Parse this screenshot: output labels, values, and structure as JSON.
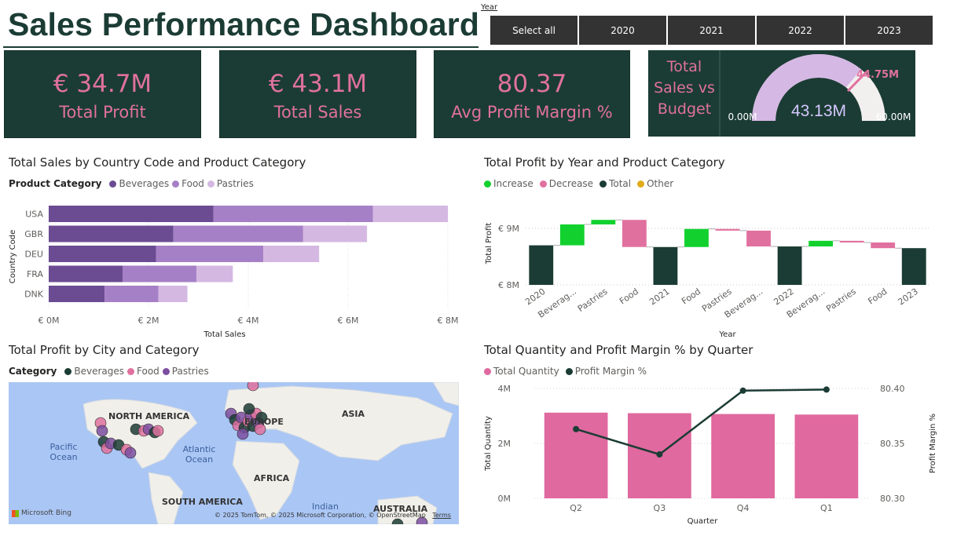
{
  "header": {
    "title": "Sales Performance Dashboard"
  },
  "slicer": {
    "label": "Year",
    "options": [
      "Select all",
      "2020",
      "2021",
      "2022",
      "2023"
    ]
  },
  "kpis": {
    "profit": {
      "value": "€ 34.7M",
      "label": "Total Profit"
    },
    "sales": {
      "value": "€ 43.1M",
      "label": "Total Sales"
    },
    "margin": {
      "value": "80.37",
      "label": "Avg Profit Margin %"
    }
  },
  "gauge": {
    "label_line1": "Total",
    "label_line2": "Sales vs",
    "label_line3": "Budget",
    "value_text": "43.13M",
    "min_text": "0.00M",
    "max_text": "60.00M",
    "target_text": "44.75M",
    "value": 43.13,
    "min": 0,
    "max": 60,
    "target": 44.75,
    "colors": {
      "fill": "#d5b8e4",
      "track": "#f2efef",
      "target": "#e0719f",
      "value_text": "#d5c8ff"
    }
  },
  "sales_chart": {
    "title": "Total Sales by Country Code and Product Category",
    "legend_title": "Product Category",
    "xlabel": "Total Sales",
    "ylabel": "Country Code",
    "x_ticks": [
      "€ 0M",
      "€ 2M",
      "€ 4M",
      "€ 6M",
      "€ 8M"
    ]
  },
  "waterfall_chart": {
    "title": "Total Profit by Year and Product Category",
    "legend": [
      "Increase",
      "Decrease",
      "Total",
      "Other"
    ],
    "xlabel": "Year",
    "ylabel": "Total Profit",
    "y_ticks": [
      "€ 9M",
      "€ 8M"
    ],
    "x_labels": [
      "2020",
      "Beverag...",
      "Pastries",
      "Food",
      "2021",
      "Food",
      "Pastries",
      "Beverag...",
      "2022",
      "Beverag...",
      "Pastries",
      "Food",
      "2023"
    ]
  },
  "map_visual": {
    "title": "Total Profit by City and Category",
    "legend_title": "Category",
    "legend": [
      "Beverages",
      "Food",
      "Pastries"
    ],
    "labels": {
      "north_america": "NORTH AMERICA",
      "europe": "EUROPE",
      "asia": "ASIA",
      "africa": "AFRICA",
      "south_america": "SOUTH AMERICA",
      "australia": "AUSTRALIA",
      "pacific": "Pacific Ocean",
      "atlantic": "Atlantic Ocean",
      "indian": "Indian"
    },
    "brand": "Microsoft Bing",
    "attribution": "© 2025 TomTom, © 2025 Microsoft Corporation, © OpenStreetMap",
    "terms": "Terms"
  },
  "combo_chart": {
    "title": "Total Quantity and Profit Margin % by Quarter",
    "legend": [
      "Total Quantity",
      "Profit Margin %"
    ],
    "xlabel": "Quarter",
    "ylabel_left": "Total Quantity",
    "ylabel_right": "Profit Margin %",
    "y_left_ticks": [
      "4M",
      "2M",
      "0M"
    ],
    "y_right_ticks": [
      "80.40",
      "80.35",
      "80.30"
    ]
  },
  "chart_data": [
    {
      "type": "bar",
      "orientation": "horizontal",
      "stacked": true,
      "title": "Total Sales by Country Code and Product Category",
      "xlabel": "Total Sales",
      "ylabel": "Country Code",
      "categories": [
        "USA",
        "GBR",
        "DEU",
        "FRA",
        "DNK"
      ],
      "series": [
        {
          "name": "Beverages",
          "color": "#6b4c93",
          "values": [
            3.3,
            2.5,
            2.15,
            1.48,
            1.12
          ]
        },
        {
          "name": "Food",
          "color": "#a680c6",
          "values": [
            3.2,
            2.6,
            2.15,
            1.48,
            1.08
          ]
        },
        {
          "name": "Pastries",
          "color": "#d4b8e2",
          "values": [
            1.5,
            1.28,
            1.12,
            0.73,
            0.58
          ]
        }
      ],
      "xlim": [
        0,
        8
      ],
      "unit": "€ M"
    },
    {
      "type": "waterfall",
      "title": "Total Profit by Year and Product Category",
      "xlabel": "Year",
      "ylabel": "Total Profit",
      "ylim": [
        7.95,
        9.25
      ],
      "unit": "€ M",
      "steps": [
        {
          "label": "2020",
          "kind": "Total",
          "start": 0,
          "end": 8.7
        },
        {
          "label": "Beverag...",
          "kind": "Increase",
          "start": 8.7,
          "end": 9.07
        },
        {
          "label": "Pastries",
          "kind": "Increase",
          "start": 9.07,
          "end": 9.15
        },
        {
          "label": "Food",
          "kind": "Decrease",
          "start": 9.15,
          "end": 8.67
        },
        {
          "label": "2021",
          "kind": "Total",
          "start": 0,
          "end": 8.67
        },
        {
          "label": "Food",
          "kind": "Increase",
          "start": 8.67,
          "end": 8.99
        },
        {
          "label": "Pastries",
          "kind": "Decrease",
          "start": 8.99,
          "end": 8.96
        },
        {
          "label": "Beverag...",
          "kind": "Decrease",
          "start": 8.96,
          "end": 8.68
        },
        {
          "label": "2022",
          "kind": "Total",
          "start": 0,
          "end": 8.68
        },
        {
          "label": "Beverag...",
          "kind": "Increase",
          "start": 8.68,
          "end": 8.78
        },
        {
          "label": "Pastries",
          "kind": "Decrease",
          "start": 8.78,
          "end": 8.75
        },
        {
          "label": "Food",
          "kind": "Decrease",
          "start": 8.75,
          "end": 8.65
        },
        {
          "label": "2023",
          "kind": "Total",
          "start": 0,
          "end": 8.65
        }
      ],
      "colors": {
        "Increase": "#12d12e",
        "Decrease": "#e0719f",
        "Total": "#1b3c34",
        "Other": "#e0ab18"
      }
    },
    {
      "type": "bar",
      "combo": true,
      "title": "Total Quantity and Profit Margin % by Quarter",
      "xlabel": "Quarter",
      "categories": [
        "Q2",
        "Q3",
        "Q4",
        "Q1"
      ],
      "series": [
        {
          "name": "Total Quantity",
          "type": "bar",
          "axis": "left",
          "color": "#e0699f",
          "values": [
            3.12,
            3.1,
            3.07,
            3.05
          ],
          "unit": "M"
        },
        {
          "name": "Profit Margin %",
          "type": "line",
          "axis": "right",
          "color": "#1b3c34",
          "values": [
            80.363,
            80.34,
            80.398,
            80.399
          ]
        }
      ],
      "ylim_left": [
        0,
        4
      ],
      "ylim_right": [
        80.3,
        80.4
      ]
    }
  ]
}
